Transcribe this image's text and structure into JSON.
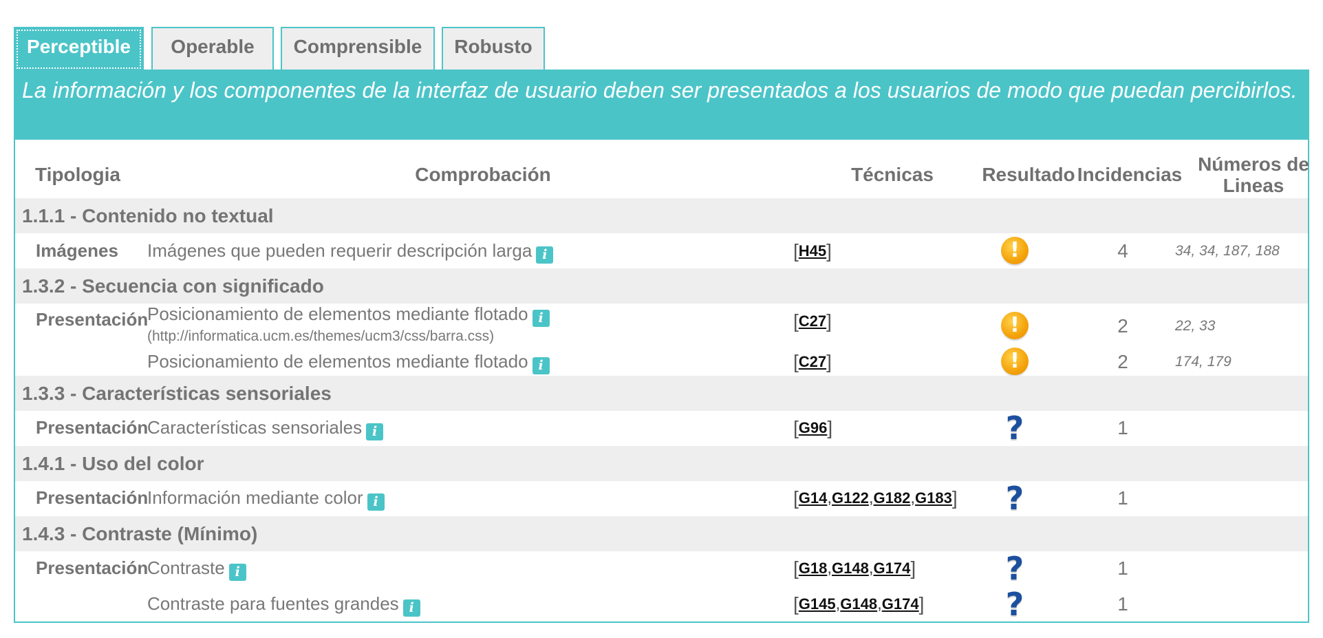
{
  "tabs": [
    "Perceptible",
    "Operable",
    "Comprensible",
    "Robusto"
  ],
  "banner": "La información y los componentes de la interfaz de usuario deben ser presentados a los usuarios de modo que puedan percibirlos.",
  "headers": {
    "tipologia": "Tipologia",
    "comprobacion": "Comprobación",
    "tecnicas": "Técnicas",
    "resultado": "Resultado",
    "incidencias": "Incidencias",
    "numeros_1": "Números de",
    "numeros_2": "Lineas"
  },
  "sections": [
    {
      "title": "1.1.1 - Contenido no textual",
      "rows": [
        {
          "tipologia": "Imágenes",
          "check": "Imágenes que pueden requerir descripción larga",
          "sub": "",
          "tecnicas": [
            "H45"
          ],
          "result": "warning-icon",
          "incidencias": "4",
          "lineas": "34, 34, 187, 188"
        }
      ]
    },
    {
      "title": "1.3.2 - Secuencia con significado",
      "rows": [
        {
          "tipologia": "Presentación",
          "check": "Posicionamiento de elementos mediante flotado",
          "sub": "(http://informatica.ucm.es/themes/ucm3/css/barra.css)",
          "tecnicas": [
            "C27"
          ],
          "result": "warning-icon",
          "incidencias": "2",
          "lineas": "22, 33"
        },
        {
          "tipologia": "",
          "check": "Posicionamiento de elementos mediante flotado",
          "sub": "",
          "tecnicas": [
            "C27"
          ],
          "result": "warning-icon",
          "incidencias": "2",
          "lineas": "174, 179"
        }
      ]
    },
    {
      "title": "1.3.3 - Características sensoriales",
      "rows": [
        {
          "tipologia": "Presentación",
          "check": "Características sensoriales",
          "sub": "",
          "tecnicas": [
            "G96"
          ],
          "result": "question-icon",
          "incidencias": "1",
          "lineas": ""
        }
      ]
    },
    {
      "title": "1.4.1 - Uso del color",
      "rows": [
        {
          "tipologia": "Presentación",
          "check": "Información mediante color",
          "sub": "",
          "tecnicas": [
            "G14",
            "G122",
            "G182",
            "G183"
          ],
          "result": "question-icon",
          "incidencias": "1",
          "lineas": ""
        }
      ]
    },
    {
      "title": "1.4.3 - Contraste (Mínimo)",
      "rows": [
        {
          "tipologia": "Presentación",
          "check": "Contraste",
          "sub": "",
          "tecnicas": [
            "G18",
            "G148",
            "G174"
          ],
          "result": "question-icon",
          "incidencias": "1",
          "lineas": ""
        },
        {
          "tipologia": "",
          "check": "Contraste para fuentes grandes",
          "sub": "",
          "tecnicas": [
            "G145",
            "G148",
            "G174"
          ],
          "result": "question-icon",
          "incidencias": "1",
          "lineas": ""
        }
      ]
    }
  ],
  "colors": {
    "accent": "#4bc4c8",
    "warning": "#f4a20a",
    "question": "#1c4f9e",
    "section_bg": "#eeeeee"
  },
  "info_icon": "i"
}
